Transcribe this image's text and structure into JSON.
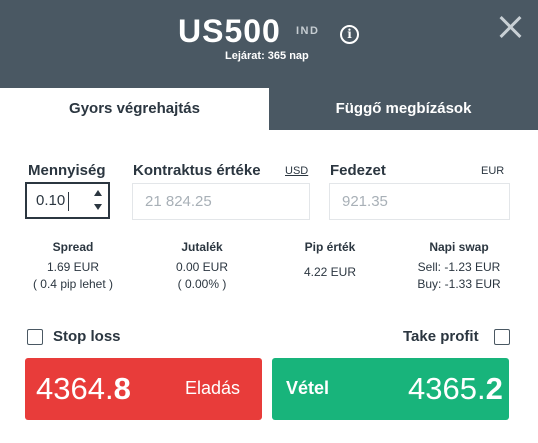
{
  "header": {
    "symbol": "US500",
    "type_badge": "IND",
    "expiry": "Lejárat: 365 nap",
    "info_icon": "info-icon",
    "close_icon": "close-icon"
  },
  "tabs": [
    {
      "label": "Gyors végrehajtás",
      "active": true
    },
    {
      "label": "Függő megbízások",
      "active": false
    }
  ],
  "quantity": {
    "label": "Mennyiség",
    "value": "0.10"
  },
  "contract": {
    "label": "Kontraktus értéke",
    "currency": "USD",
    "value": "21 824.25"
  },
  "margin": {
    "label": "Fedezet",
    "currency": "EUR",
    "value": "921.35"
  },
  "stats": {
    "spread": {
      "title": "Spread",
      "line1": "1.69 EUR",
      "line2": "( 0.4 pip lehet )"
    },
    "commission": {
      "title": "Jutalék",
      "line1": "0.00 EUR",
      "line2": "( 0.00% )"
    },
    "pip": {
      "title": "Pip érték",
      "line1": "4.22 EUR"
    },
    "swap": {
      "title": "Napi swap",
      "line1": "Sell: -1.23 EUR",
      "line2": "Buy: -1.33 EUR"
    }
  },
  "options": {
    "stop_loss": "Stop loss",
    "take_profit": "Take profit"
  },
  "sell": {
    "label": "Eladás",
    "price_main": "4364.",
    "price_big": "8",
    "color": "#e83c3a"
  },
  "buy": {
    "label": "Vétel",
    "price_main": "4365.",
    "price_big": "2",
    "color": "#18b47b"
  },
  "colors": {
    "header": "#4a5863",
    "text": "#2b3640"
  }
}
